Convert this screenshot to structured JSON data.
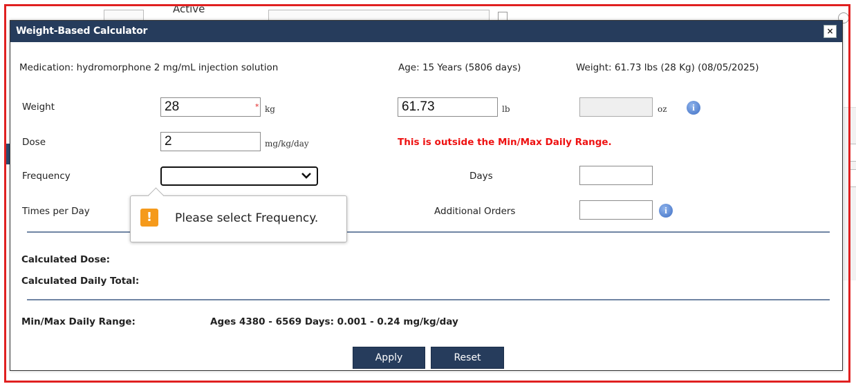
{
  "background": {
    "active_label": "Active"
  },
  "dialog": {
    "title": "Weight-Based Calculator",
    "close_label": "×",
    "medication": "Medication: hydromorphone 2 mg/mL injection solution",
    "age": "Age: 15 Years (5806 days)",
    "weight_info": "Weight: 61.73 lbs (28 Kg) (08/05/2025)",
    "weight": {
      "label": "Weight",
      "kg_value": "28",
      "kg_unit": "kg",
      "required_mark": "*",
      "lb_value": "61.73",
      "lb_unit": "lb",
      "oz_value": "",
      "oz_unit": "oz"
    },
    "dose": {
      "label": "Dose",
      "value": "2",
      "unit": "mg/kg/day",
      "warning": "This is outside the Min/Max Daily Range."
    },
    "frequency": {
      "label": "Frequency",
      "selected": ""
    },
    "days": {
      "label": "Days",
      "value": ""
    },
    "times_per_day": {
      "label": "Times per Day"
    },
    "additional_orders": {
      "label": "Additional Orders",
      "value": ""
    },
    "tooltip": {
      "icon": "!",
      "message": "Please select Frequency."
    },
    "calculated_dose_label": "Calculated Dose:",
    "calculated_daily_total_label": "Calculated Daily Total:",
    "min_max": {
      "label": "Min/Max Daily Range:",
      "value": "Ages 4380 - 6569 Days: 0.001 - 0.24 mg/kg/day"
    },
    "buttons": {
      "apply": "Apply",
      "reset": "Reset"
    },
    "icons": {
      "info": "info-icon",
      "warning": "warning-icon",
      "close": "close-icon",
      "dropdown": "chevron-down-icon"
    },
    "colors": {
      "titlebar": "#263c5c",
      "warning_text": "#ee1111",
      "tooltip_icon": "#f59a1b"
    }
  }
}
